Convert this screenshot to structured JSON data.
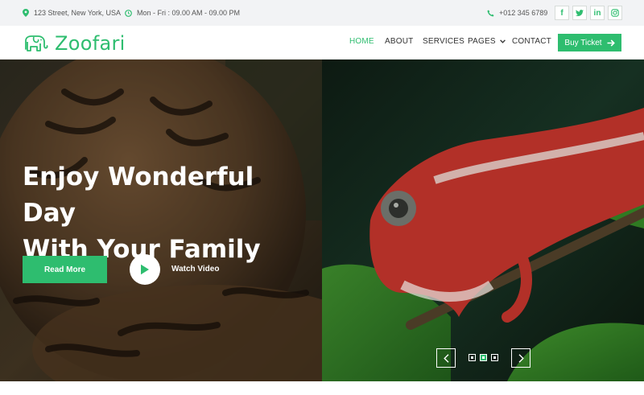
{
  "topbar": {
    "address": "123 Street, New York, USA",
    "hours": "Mon - Fri : 09.00 AM - 09.00 PM",
    "phone": "+012 345 6789",
    "social": [
      "f",
      "t",
      "in",
      "ig"
    ]
  },
  "navbar": {
    "brand": "Zoofari",
    "links": [
      "HOME",
      "ABOUT",
      "SERVICES",
      "PAGES",
      "CONTACT"
    ],
    "active_link": "HOME",
    "cta": "Buy Ticket"
  },
  "hero": {
    "title_line1": "Enjoy Wonderful Day",
    "title_line2": "With Your Family",
    "read_more": "Read More",
    "watch_video": "Watch Video",
    "slides_total": 3,
    "active_slide": 2
  },
  "colors": {
    "accent": "#2ebd6f",
    "topbar_bg": "#f2f3f5"
  },
  "icons": [
    "map-marker-icon",
    "clock-icon",
    "phone-icon",
    "facebook-icon",
    "twitter-icon",
    "linkedin-icon",
    "instagram-icon",
    "elephant-logo-icon",
    "chevron-down-icon",
    "arrow-right-icon",
    "play-icon",
    "chevron-left-icon",
    "chevron-right-icon"
  ]
}
